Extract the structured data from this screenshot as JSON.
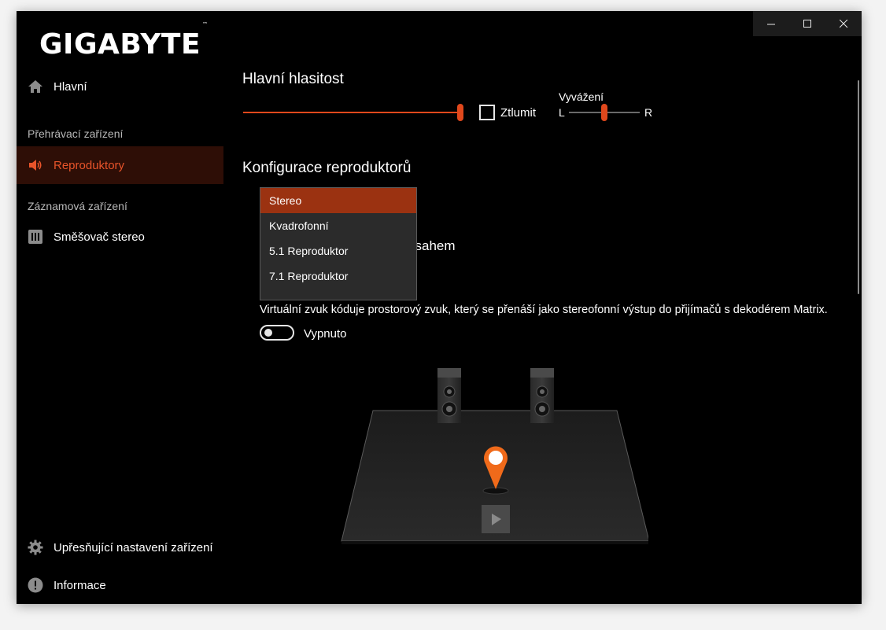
{
  "window": {
    "controls": {
      "minimize": "minimize-icon",
      "maximize": "maximize-icon",
      "close": "close-icon"
    }
  },
  "sidebar": {
    "logo": "GIGABYTE",
    "logo_tm": "™",
    "items": [
      {
        "label": "Hlavní",
        "icon": "home-icon"
      },
      {
        "label": "Reproduktory",
        "icon": "speaker-icon",
        "active": true
      },
      {
        "label": "Směšovač stereo",
        "icon": "mixer-icon"
      },
      {
        "label": "Upřesňující nastavení zařízení",
        "icon": "gear-icon"
      },
      {
        "label": "Informace",
        "icon": "info-icon"
      }
    ],
    "sections": {
      "playback": "Přehrávací zařízení",
      "recording": "Záznamová zařízení"
    }
  },
  "main": {
    "volume": {
      "title": "Hlavní hlasitost",
      "level": 1.0,
      "mute_label": "Ztlumit",
      "mute_checked": false,
      "balance_label": "Vyvážení",
      "balance_left": "L",
      "balance_right": "R",
      "balance_level": 0.5
    },
    "speaker_config": {
      "title": "Konfigurace reproduktorů",
      "options": [
        "Stereo",
        "Kvadrofonní",
        "5.1 Reproduktor",
        "7.1 Reproduktor"
      ],
      "selected": "Stereo",
      "hidden_fragment": "zsahem"
    },
    "virtual": {
      "description": "Virtuální zvuk kóduje prostorový zvuk, který se přenáší jako stereofonní výstup do přijímačů s dekodérem Matrix.",
      "toggle_label": "Vypnuto",
      "enabled": false
    }
  },
  "colors": {
    "accent": "#e0481c",
    "active_bg": "#2e0e06",
    "dropdown_selected": "#9b3211",
    "background": "#000000"
  }
}
